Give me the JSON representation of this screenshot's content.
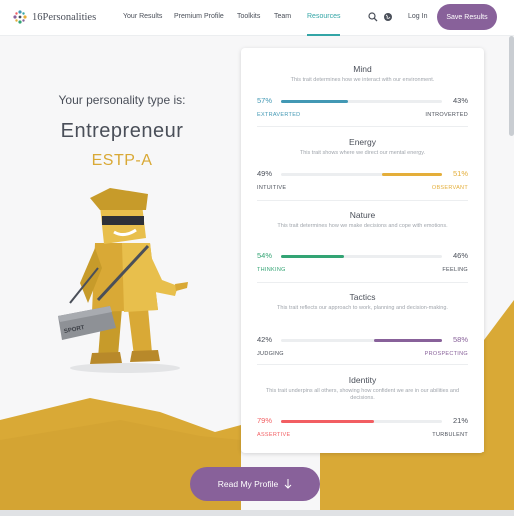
{
  "nav": {
    "logo_text": "16Personalities",
    "links": [
      "Your Results",
      "Premium Profile",
      "Toolkits",
      "Team",
      "Resources"
    ],
    "active": "Resources",
    "login": "Log In",
    "save": "Save Results"
  },
  "hero": {
    "intro": "Your personality type is:",
    "type_name": "Entrepreneur",
    "type_code": "ESTP-A",
    "bag_label": "SPORT"
  },
  "traits": [
    {
      "title": "Mind",
      "desc": "This trait determines how we interact with our environment.",
      "left_pct": "57%",
      "right_pct": "43%",
      "left_label": "EXTRAVERTED",
      "right_label": "INTROVERTED",
      "dominant": "left",
      "fill": 0.57,
      "color": "#4298b4"
    },
    {
      "title": "Energy",
      "desc": "This trait shows where we direct our mental energy.",
      "left_pct": "49%",
      "right_pct": "51%",
      "left_label": "INTUITIVE",
      "right_label": "OBSERVANT",
      "dominant": "right",
      "fill": 0.51,
      "color": "#e4ae3a"
    },
    {
      "title": "Nature",
      "desc": "This trait determines how we make decisions and cope with emotions.",
      "left_pct": "54%",
      "right_pct": "46%",
      "left_label": "THINKING",
      "right_label": "FEELING",
      "dominant": "left",
      "fill": 0.54,
      "color": "#33a474"
    },
    {
      "title": "Tactics",
      "desc": "This trait reflects our approach to work, planning and decision-making.",
      "left_pct": "42%",
      "right_pct": "58%",
      "left_label": "JUDGING",
      "right_label": "PROSPECTING",
      "dominant": "right",
      "fill": 0.58,
      "color": "#88619a"
    },
    {
      "title": "Identity",
      "desc": "This trait underpins all others, showing how confident we are in our abilities and decisions.",
      "left_pct": "79%",
      "right_pct": "21%",
      "left_label": "ASSERTIVE",
      "right_label": "TURBULENT",
      "dominant": "left",
      "fill": 0.79,
      "color": "#f25e62"
    }
  ],
  "cta": {
    "read_profile": "Read My Profile"
  },
  "colors": {
    "accent": "#88619a",
    "gold": "#d9a936",
    "teal": "#33a5a6"
  }
}
